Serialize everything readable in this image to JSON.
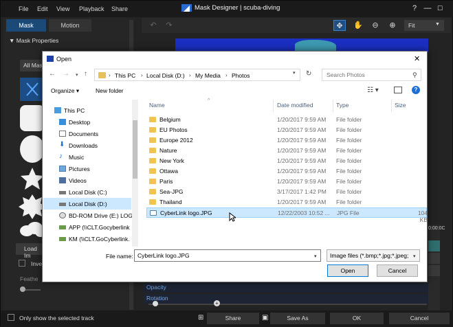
{
  "app": {
    "menu": [
      "File",
      "Edit",
      "View",
      "Playback",
      "Share"
    ],
    "title": "Mask Designer | scuba-diving",
    "window_controls": [
      "?",
      "—",
      "☐",
      "✕"
    ],
    "tabs": [
      "Mask",
      "Motion"
    ],
    "mask_properties_label": "Mask Properties",
    "all_masks_label": "All Mas",
    "load_image_label": "Load Im",
    "invert_label": "Inve",
    "feather_label": "Feathe",
    "zoom_value": "Fit",
    "timecode": "0:00:0C",
    "timeline_labels": [
      "Opacity",
      "Rotation"
    ],
    "only_selected_track_label": "Only show the selected track",
    "bottom_buttons": [
      "Share",
      "Save As",
      "OK",
      "Cancel"
    ]
  },
  "dialog": {
    "title": "Open",
    "breadcrumbs": [
      "This PC",
      "Local Disk (D:)",
      "My Media",
      "Photos"
    ],
    "search_placeholder": "Search Photos",
    "organize_label": "Organize ▾",
    "new_folder_label": "New folder",
    "nav_items": [
      {
        "label": "This PC",
        "icon": "pc-icon"
      },
      {
        "label": "Desktop",
        "icon": "desktop-icon"
      },
      {
        "label": "Documents",
        "icon": "documents-icon"
      },
      {
        "label": "Downloads",
        "icon": "downloads-icon"
      },
      {
        "label": "Music",
        "icon": "music-icon"
      },
      {
        "label": "Pictures",
        "icon": "pictures-icon"
      },
      {
        "label": "Videos",
        "icon": "videos-icon"
      },
      {
        "label": "Local Disk (C:)",
        "icon": "drive-icon"
      },
      {
        "label": "Local Disk (D:)",
        "icon": "drive-icon"
      },
      {
        "label": "BD-ROM Drive (E:) LOGI",
        "icon": "disc-drive-icon"
      },
      {
        "label": "APP (\\\\CLT.Gocyberlink",
        "icon": "network-drive-icon"
      },
      {
        "label": "KM (\\\\CLT.GoCyberlink.",
        "icon": "network-drive-icon"
      }
    ],
    "columns": [
      "Name",
      "Date modified",
      "Type",
      "Size"
    ],
    "files": [
      {
        "name": "Belgium",
        "date": "1/20/2017 9:59 AM",
        "type": "File folder",
        "size": ""
      },
      {
        "name": "EU Photos",
        "date": "1/20/2017 9:59 AM",
        "type": "File folder",
        "size": ""
      },
      {
        "name": "Europe 2012",
        "date": "1/20/2017 9:59 AM",
        "type": "File folder",
        "size": ""
      },
      {
        "name": "Nature",
        "date": "1/20/2017 9:59 AM",
        "type": "File folder",
        "size": ""
      },
      {
        "name": "New York",
        "date": "1/20/2017 9:59 AM",
        "type": "File folder",
        "size": ""
      },
      {
        "name": "Ottawa",
        "date": "1/20/2017 9:59 AM",
        "type": "File folder",
        "size": ""
      },
      {
        "name": "Paris",
        "date": "1/20/2017 9:59 AM",
        "type": "File folder",
        "size": ""
      },
      {
        "name": "Sea-JPG",
        "date": "3/17/2017 1:42 PM",
        "type": "File folder",
        "size": ""
      },
      {
        "name": "Thailand",
        "date": "1/20/2017 9:59 AM",
        "type": "File folder",
        "size": ""
      },
      {
        "name": "CyberLink logo.JPG",
        "date": "12/22/2003 10:52 ...",
        "type": "JPG File",
        "size": "104 KB"
      }
    ],
    "file_name_label": "File name:",
    "file_name_value": "CyberLink logo.JPG",
    "file_type_value": "Image files (*.bmp;*.jpg;*.jpeg;",
    "open_label": "Open",
    "cancel_label": "Cancel"
  }
}
